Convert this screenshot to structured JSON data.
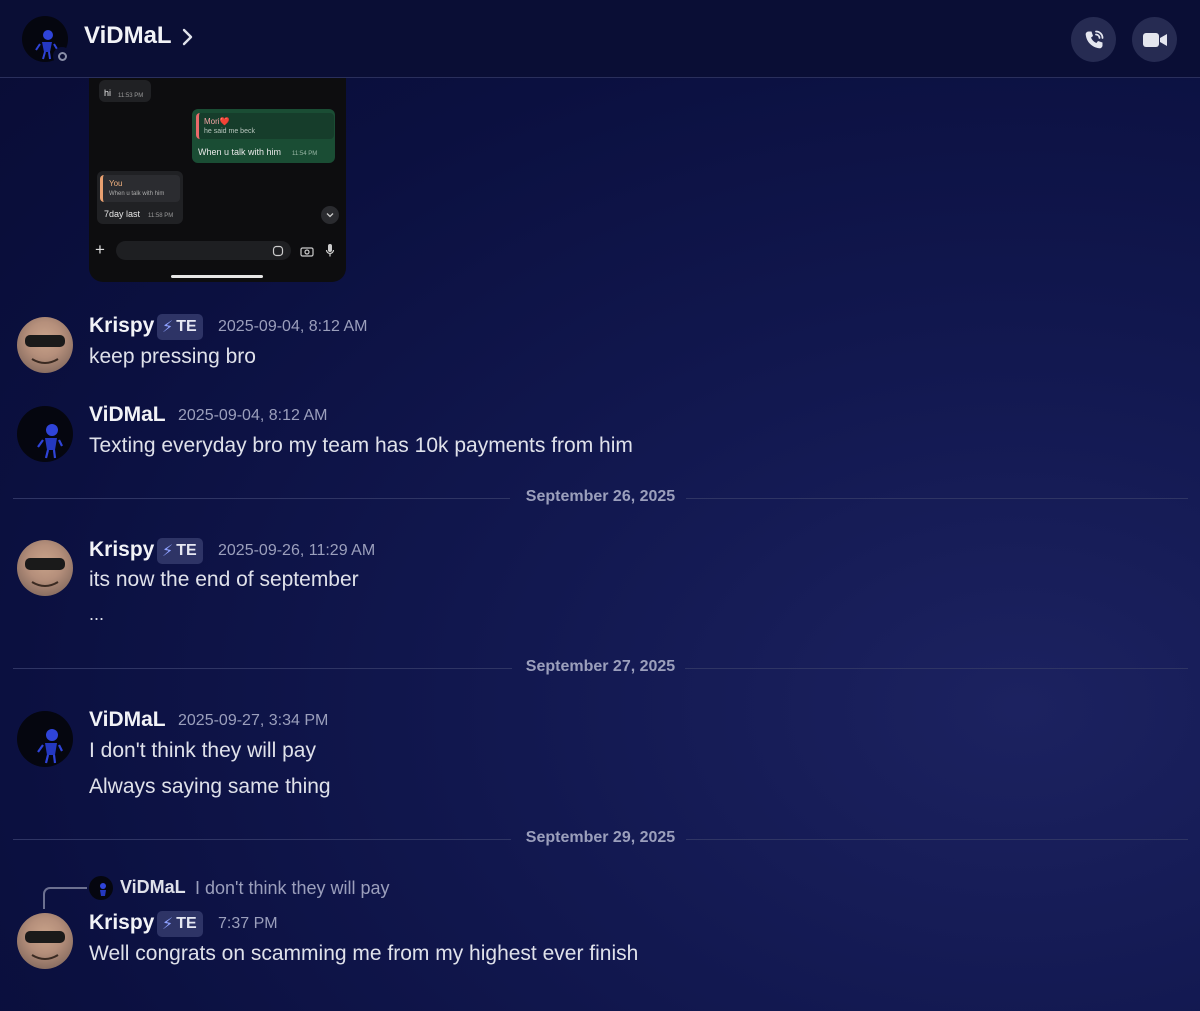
{
  "header": {
    "title": "ViDMaL",
    "chevron_icon": "chevron-right-icon",
    "call_icon": "phone-call-icon",
    "video_icon": "video-camera-icon"
  },
  "embed": {
    "msg1_text": "hi",
    "msg1_time": "11:53 PM",
    "msg2_quote_name": "Mori❤️",
    "msg2_quote_text": "he said me beck",
    "msg2_text": "When u talk with him",
    "msg2_time": "11:54 PM",
    "msg3_quote_name": "You",
    "msg3_quote_text": "When u talk with him",
    "msg3_text": "7day last",
    "msg3_time": "11:58 PM"
  },
  "messages": [
    {
      "author": "Krispy",
      "badge": "TE",
      "timestamp": "2025-09-04, 8:12 AM",
      "lines": [
        "keep pressing bro"
      ]
    },
    {
      "author": "ViDMaL",
      "timestamp": "2025-09-04, 8:12 AM",
      "lines": [
        "Texting everyday bro my team has 10k payments from him"
      ]
    },
    {
      "author": "Krispy",
      "badge": "TE",
      "timestamp": "2025-09-26, 11:29 AM",
      "lines": [
        "its now the end of september",
        "..."
      ]
    },
    {
      "author": "ViDMaL",
      "timestamp": "2025-09-27, 3:34 PM",
      "lines": [
        "I don't think they will pay",
        "Always saying same thing"
      ]
    },
    {
      "author": "Krispy",
      "badge": "TE",
      "timestamp": "7:37 PM",
      "lines": [
        "Well congrats on scamming me from my highest ever finish"
      ],
      "reply": {
        "author": "ViDMaL",
        "text": "I don't think they will pay"
      }
    }
  ],
  "dividers": [
    "September 26, 2025",
    "September 27, 2025",
    "September 29, 2025"
  ],
  "colors": {
    "background": "#0b1040",
    "header": "#0a0e35",
    "badge": "#2e3466",
    "accent_bolt": "#8ea1ff"
  }
}
